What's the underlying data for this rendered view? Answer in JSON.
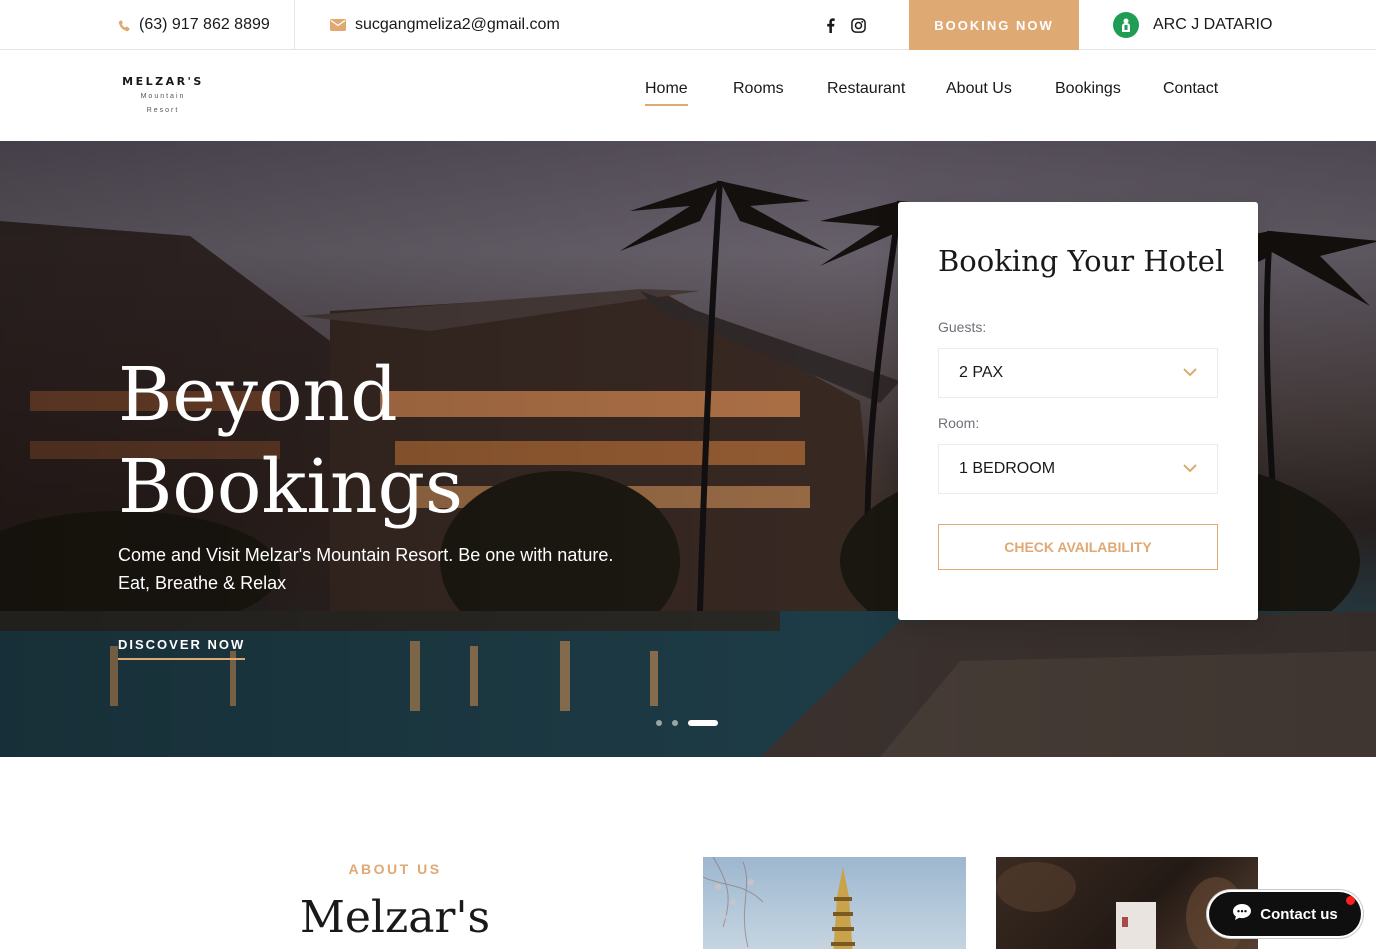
{
  "topbar": {
    "phone": "(63) 917 862 8899",
    "email": "sucgangmeliza2@gmail.com",
    "social": [
      "facebook-icon",
      "instagram-icon"
    ],
    "booking_button": "BOOKING NOW",
    "user_name": "ARC J DATARIO"
  },
  "brand": {
    "name": "MELZAR'S",
    "sub1": "Mountain",
    "sub2": "Resort"
  },
  "nav": {
    "items": [
      {
        "label": "Home",
        "active": true
      },
      {
        "label": "Rooms",
        "active": false
      },
      {
        "label": "Restaurant",
        "active": false
      },
      {
        "label": "About Us",
        "active": false
      },
      {
        "label": "Bookings",
        "active": false
      },
      {
        "label": "Contact",
        "active": false
      }
    ]
  },
  "hero": {
    "title_line1": "Beyond",
    "title_line2": "Bookings",
    "subtitle": "Come and Visit Melzar's Mountain Resort. Be one with nature. Eat, Breathe & Relax",
    "cta": "DISCOVER NOW",
    "slides": 3,
    "active_slide": 3
  },
  "booking_form": {
    "title": "Booking Your Hotel",
    "guests_label": "Guests:",
    "guests_value": "2 PAX",
    "room_label": "Room:",
    "room_value": "1 BEDROOM",
    "button": "CHECK AVAILABILITY"
  },
  "about": {
    "tag": "ABOUT US",
    "title": "Melzar's"
  },
  "contact_widget": {
    "label": "Contact us"
  },
  "colors": {
    "accent": "#dfa974",
    "text": "#19191b",
    "muted": "#707079",
    "user_avatar": "#1f9d55",
    "notification": "#ff1f1f"
  }
}
